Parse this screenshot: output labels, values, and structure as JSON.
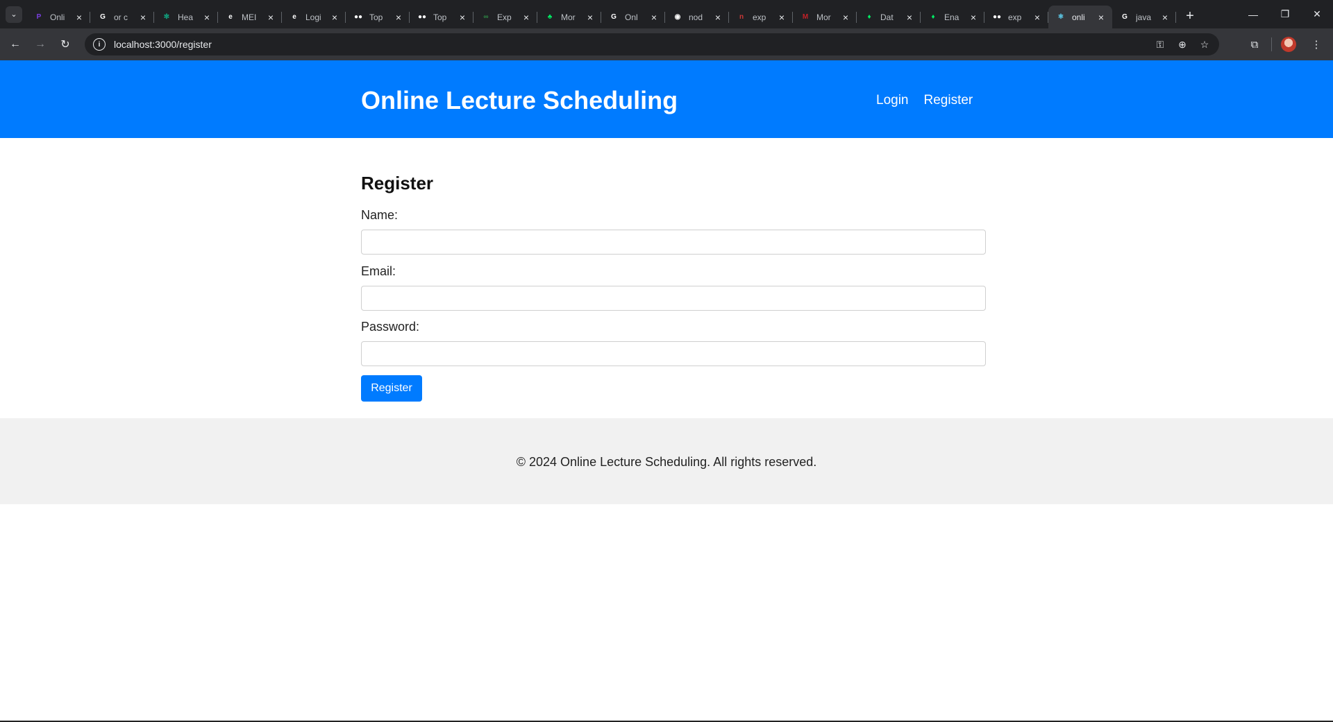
{
  "browser": {
    "tabs": [
      {
        "title": "Onli",
        "favicon_color": "#7b3fe4",
        "favicon_glyph": "P",
        "icon": "perplexity-icon"
      },
      {
        "title": "or c",
        "favicon_color": "#ffffff",
        "favicon_glyph": "G",
        "icon": "google-icon"
      },
      {
        "title": "Hea",
        "favicon_color": "#10a37f",
        "favicon_glyph": "✻",
        "icon": "chatgpt-icon"
      },
      {
        "title": "MEI",
        "favicon_color": "#ffffff",
        "favicon_glyph": "e",
        "icon": "site-icon"
      },
      {
        "title": "Logi",
        "favicon_color": "#ffffff",
        "favicon_glyph": "e",
        "icon": "site-icon"
      },
      {
        "title": "Top",
        "favicon_color": "#ffffff",
        "favicon_glyph": "●●",
        "icon": "medium-icon"
      },
      {
        "title": "Top",
        "favicon_color": "#ffffff",
        "favicon_glyph": "●●",
        "icon": "medium-icon"
      },
      {
        "title": "Exp",
        "favicon_color": "#2f8d46",
        "favicon_glyph": "∞",
        "icon": "geeksforgeeks-icon"
      },
      {
        "title": "Mor",
        "favicon_color": "#00ed64",
        "favicon_glyph": "♣",
        "icon": "mongodb-icon"
      },
      {
        "title": "Onl",
        "favicon_color": "#ffffff",
        "favicon_glyph": "G",
        "icon": "google-icon"
      },
      {
        "title": "nod",
        "favicon_color": "#ffffff",
        "favicon_glyph": "◉",
        "icon": "github-icon"
      },
      {
        "title": "exp",
        "favicon_color": "#cb3837",
        "favicon_glyph": "n",
        "icon": "npm-icon"
      },
      {
        "title": "Mor",
        "favicon_color": "#c12127",
        "favicon_glyph": "M",
        "icon": "site-icon"
      },
      {
        "title": "Dat",
        "favicon_color": "#00ed64",
        "favicon_glyph": "♦",
        "icon": "mongodb-icon"
      },
      {
        "title": "Ena",
        "favicon_color": "#00ed64",
        "favicon_glyph": "♦",
        "icon": "mongodb-icon"
      },
      {
        "title": "exp",
        "favicon_color": "#ffffff",
        "favicon_glyph": "●●",
        "icon": "medium-icon"
      },
      {
        "title": "onli",
        "favicon_color": "#61dafb",
        "favicon_glyph": "⚛",
        "icon": "react-icon",
        "active": true
      },
      {
        "title": "java",
        "favicon_color": "#ffffff",
        "favicon_glyph": "G",
        "icon": "google-icon"
      }
    ],
    "url": "localhost:3000/register",
    "accent_dark": "#202124"
  },
  "site": {
    "brand": "Online Lecture Scheduling",
    "nav": {
      "login": "Login",
      "register": "Register"
    },
    "brand_color": "#007bff"
  },
  "form": {
    "title": "Register",
    "name_label": "Name:",
    "email_label": "Email:",
    "password_label": "Password:",
    "name_value": "",
    "email_value": "",
    "password_value": "",
    "submit_label": "Register"
  },
  "footer": {
    "text": "© 2024 Online Lecture Scheduling. All rights reserved."
  }
}
